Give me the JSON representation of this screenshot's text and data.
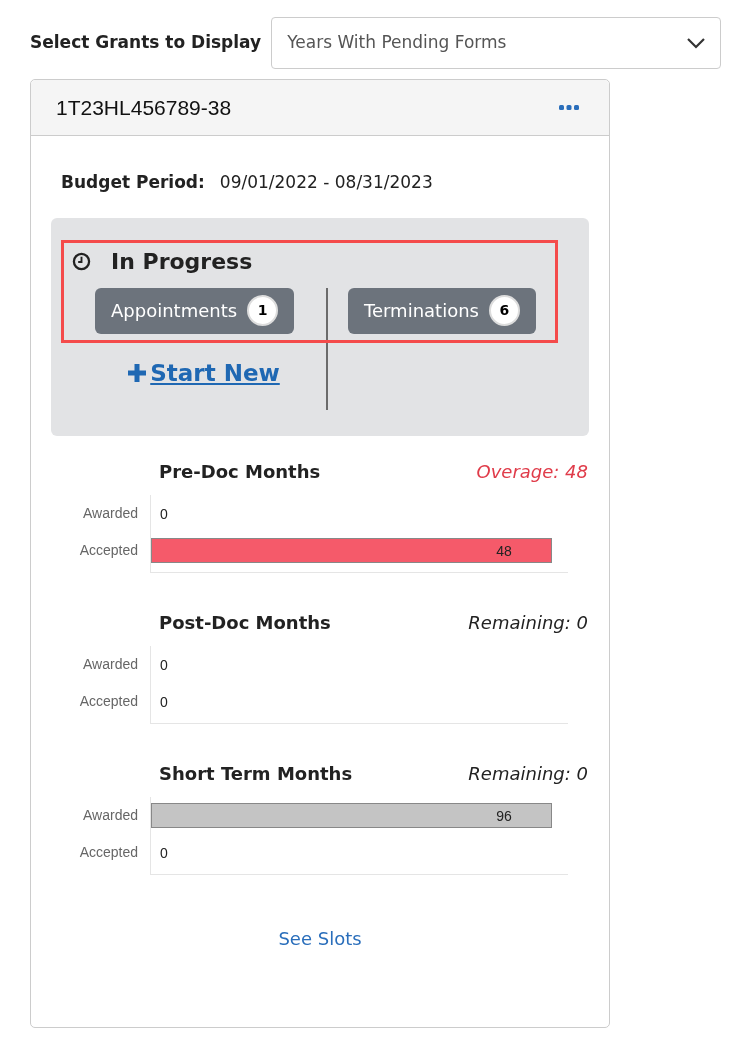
{
  "filter": {
    "label": "Select Grants to Display",
    "value": "Years With Pending Forms"
  },
  "grant": {
    "id": "1T23HL456789-38",
    "budget_label": "Budget Period:",
    "budget_value": "09/01/2022 - 08/31/2023",
    "status": {
      "title": "In Progress",
      "highlighted": true,
      "buttons": [
        {
          "label": "Appointments",
          "count": "1"
        },
        {
          "label": "Terminations",
          "count": "6"
        }
      ],
      "start_new": "Start New"
    },
    "charts": [
      {
        "title": "Pre-Doc Months",
        "summary": "Overage: 48",
        "kind": "overage",
        "color": "#f55a6a",
        "rows": [
          {
            "label": "Awarded",
            "value": "0"
          },
          {
            "label": "Accepted",
            "value": "48",
            "level": 0.96
          }
        ]
      },
      {
        "title": "Post-Doc Months",
        "summary": "Remaining: 0",
        "kind": "remaining",
        "rows": [
          {
            "label": "Awarded",
            "value": "0"
          },
          {
            "label": "Accepted",
            "value": "0"
          }
        ]
      },
      {
        "title": "Short Term Months",
        "summary": "Remaining: 0",
        "kind": "remaining",
        "color": "#c4c4c4",
        "rows": [
          {
            "label": "Awarded",
            "value": "96",
            "level": 0.96
          },
          {
            "label": "Accepted",
            "value": "0"
          }
        ]
      }
    ],
    "link": "See Slots"
  }
}
